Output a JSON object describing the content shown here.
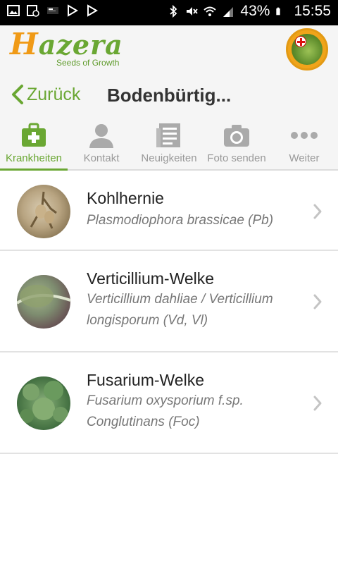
{
  "status_bar": {
    "battery_percent": "43%",
    "time": "15:55",
    "icons_left": [
      "image-icon",
      "clock-calendar-icon",
      "news-icon",
      "play-store-icon",
      "play-store-icon"
    ],
    "icons_right": [
      "bluetooth-icon",
      "mute-icon",
      "wifi-icon",
      "signal-icon",
      "battery-icon"
    ]
  },
  "header": {
    "logo_text": "Hazera",
    "logo_tagline": "Seeds of Growth",
    "badge_icon": "plant-health-badge-icon"
  },
  "nav": {
    "back_label": "Zurück",
    "title": "Bodenbürtig..."
  },
  "tabs": [
    {
      "label": "Krankheiten",
      "icon": "first-aid-kit-icon",
      "active": true
    },
    {
      "label": "Kontakt",
      "icon": "person-icon",
      "active": false
    },
    {
      "label": "Neuigkeiten",
      "icon": "news-icon",
      "active": false
    },
    {
      "label": "Foto senden",
      "icon": "camera-icon",
      "active": false
    },
    {
      "label": "Weiter",
      "icon": "more-dots-icon",
      "active": false
    }
  ],
  "diseases": [
    {
      "name": "Kohlhernie",
      "latin": "Plasmodiophora brassicae (Pb)"
    },
    {
      "name": "Verticillium-Welke",
      "latin": "Verticillium dahliae / Verticillium longisporum (Vd, Vl)"
    },
    {
      "name": "Fusarium-Welke",
      "latin": "Fusarium oxysporium f.sp. Conglutinans (Foc)"
    }
  ],
  "colors": {
    "accent_green": "#6aa733",
    "logo_orange": "#f09a16",
    "inactive_gray": "#999999"
  }
}
